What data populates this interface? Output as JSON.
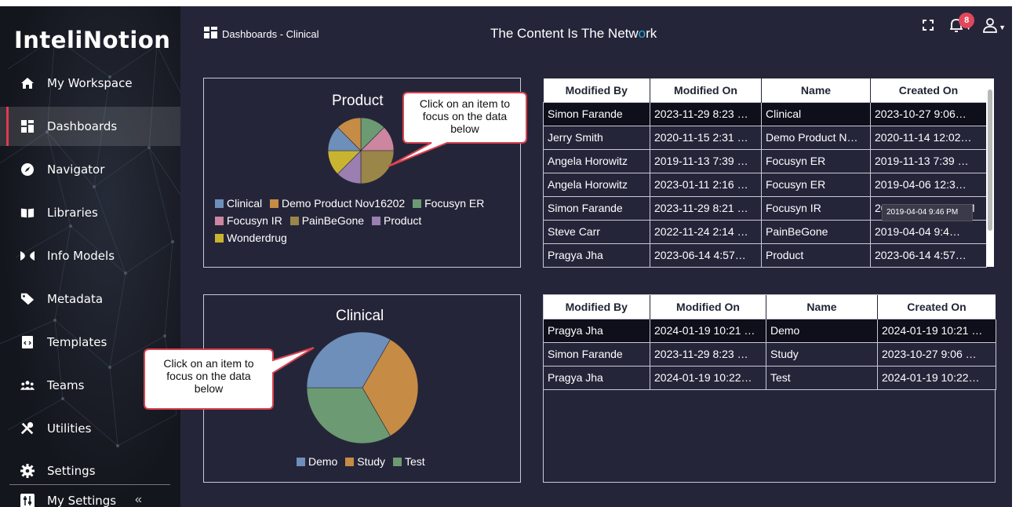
{
  "app": {
    "logo": "InteliNotion"
  },
  "sidebar": {
    "items": [
      {
        "label": "My Workspace",
        "icon": "home-icon"
      },
      {
        "label": "Dashboards",
        "icon": "grid-icon",
        "active": true
      },
      {
        "label": "Navigator",
        "icon": "compass-icon"
      },
      {
        "label": "Libraries",
        "icon": "book-icon"
      },
      {
        "label": "Info Models",
        "icon": "bowtie-icon"
      },
      {
        "label": "Metadata",
        "icon": "tag-icon"
      },
      {
        "label": "Templates",
        "icon": "template-icon"
      },
      {
        "label": "Teams",
        "icon": "users-icon"
      },
      {
        "label": "Utilities",
        "icon": "tools-icon"
      },
      {
        "label": "Settings",
        "icon": "gear-icon"
      }
    ],
    "my_settings": "My Settings",
    "collapse_glyph": "«"
  },
  "header": {
    "breadcrumb": "Dashboards - Clinical",
    "tagline_before": "The Content Is The Netw",
    "tagline_dot": "o",
    "tagline_after": "rk",
    "notification_count": "8"
  },
  "colors": {
    "clinical": "#6e8fba",
    "demo_product": "#c68b44",
    "focusyn_er": "#6c9a72",
    "focusyn_ir": "#cc86a0",
    "painbegone": "#9a8648",
    "product": "#9b7fb0",
    "wonderdrug": "#c8b430",
    "demo": "#6e8fba",
    "study": "#c68b44",
    "test": "#6c9a72"
  },
  "product_chart": {
    "title": "Product",
    "chart_data": {
      "type": "pie",
      "title": "Product",
      "labels": [
        "Clinical",
        "Demo Product Nov16202",
        "Focusyn ER",
        "Focusyn IR",
        "PainBeGone",
        "Product",
        "Wonderdrug"
      ],
      "values": [
        1,
        1,
        2,
        1,
        1,
        1,
        1
      ]
    },
    "legend": [
      "Clinical",
      "Demo Product Nov16202",
      "Focusyn ER",
      "Focusyn IR",
      "PainBeGone",
      "Product",
      "Wonderdrug"
    ],
    "callout": [
      "Click on an item to",
      "focus on the data",
      "below"
    ]
  },
  "clinical_chart": {
    "title": "Clinical",
    "chart_data": {
      "type": "pie",
      "title": "Clinical",
      "labels": [
        "Demo",
        "Study",
        "Test"
      ],
      "values": [
        1,
        1,
        1
      ]
    },
    "legend": [
      "Demo",
      "Study",
      "Test"
    ],
    "callout": [
      "Click on an item to",
      "focus on the data",
      "below"
    ]
  },
  "table1": {
    "columns": [
      "Modified By",
      "Modified On",
      "Name",
      "Created On"
    ],
    "rows": [
      [
        "Simon Farande",
        "2023-11-29 8:23 …",
        "Clinical",
        "2023-10-27 9:06…"
      ],
      [
        "Jerry Smith",
        "2020-11-15 2:31 …",
        "Demo Product N…",
        "2020-11-14 12:02…"
      ],
      [
        "Angela Horowitz",
        "2019-11-13 7:39 …",
        "Focusyn ER",
        "2019-11-13 7:39 …"
      ],
      [
        "Angela Horowitz",
        "2023-01-11 2:16 …",
        "Focusyn ER",
        "2019-04-06 12:3…"
      ],
      [
        "Simon Farande",
        "2023-11-29 8:21 …",
        "Focusyn IR",
        "2019-04-04 9:46 PM"
      ],
      [
        "Steve Carr",
        "2022-11-24 2:14 …",
        "PainBeGone",
        "2019-04-04 9:4…"
      ],
      [
        "Pragya Jha",
        "2023-06-14 4:57…",
        "Product",
        "2023-06-14 4:57…"
      ]
    ],
    "tooltip": "2019-04-04 9:46 PM"
  },
  "table2": {
    "columns": [
      "Modified By",
      "Modified On",
      "Name",
      "Created On"
    ],
    "rows": [
      [
        "Pragya Jha",
        "2024-01-19 10:21 …",
        "Demo",
        "2024-01-19 10:21 …"
      ],
      [
        "Simon Farande",
        "2023-11-29 8:23 …",
        "Study",
        "2023-10-27 9:06 …"
      ],
      [
        "Pragya Jha",
        "2024-01-19 10:22…",
        "Test",
        "2024-01-19 10:22…"
      ]
    ]
  }
}
